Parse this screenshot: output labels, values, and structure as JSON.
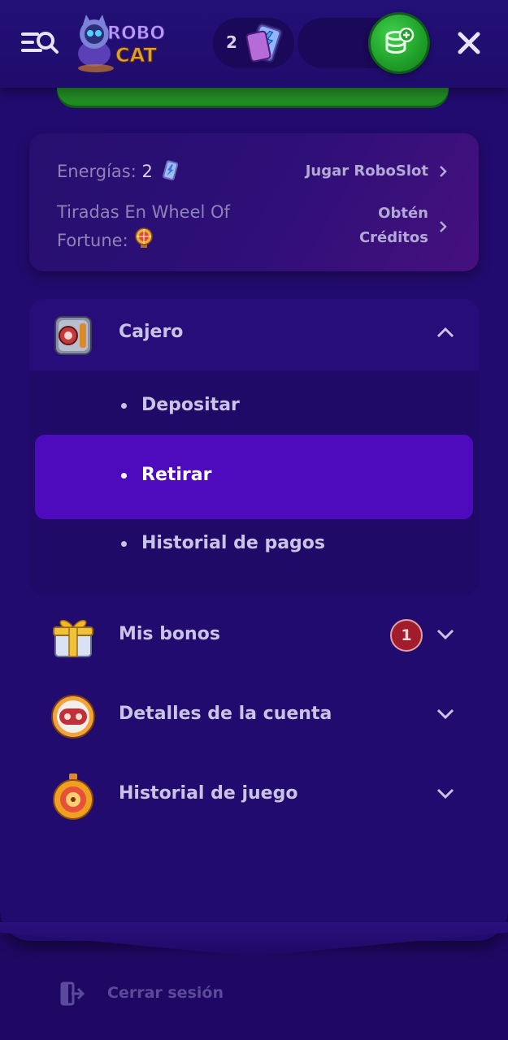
{
  "header": {
    "logo_text_top": "ROBO",
    "logo_text_bottom": "CAT",
    "energy_count": "2",
    "icons": {
      "menu": "menu-search-icon",
      "energy": "energy-card-icon",
      "deposit": "coin-stack-plus-icon",
      "close": "close-icon"
    }
  },
  "info_card": {
    "energies_label": "Energías:",
    "energies_value": "2",
    "energies_link": "Jugar RoboSlot",
    "wheel_label_line1": "Tiradas En Wheel Of",
    "wheel_label_line2": "Fortune:",
    "wheel_link_line1": "Obtén",
    "wheel_link_line2": "Créditos"
  },
  "menu": {
    "cashier": {
      "label": "Cajero",
      "expanded": true,
      "items": [
        {
          "label": "Depositar",
          "active": false
        },
        {
          "label": "Retirar",
          "active": true
        },
        {
          "label": "Historial de pagos",
          "active": false
        }
      ]
    },
    "bonuses": {
      "label": "Mis bonos",
      "badge": "1"
    },
    "account": {
      "label": "Detalles de la cuenta"
    },
    "game_history": {
      "label": "Historial de juego"
    }
  },
  "logout": {
    "label": "Cerrar sesión"
  },
  "colors": {
    "background": "#1e0863",
    "panel": "#210b6e",
    "active_item": "#4d0bbd",
    "accent_green": "#1f9e2a",
    "badge_red": "#a11d2c"
  }
}
